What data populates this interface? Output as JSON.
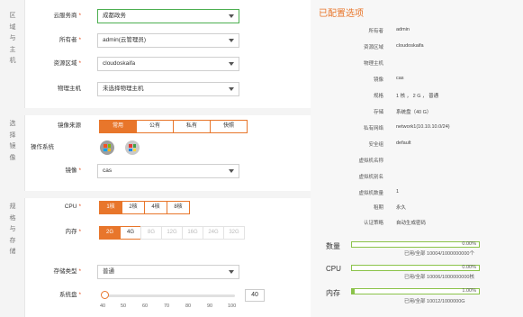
{
  "sections": {
    "region": {
      "tab_label": "区域与主机"
    },
    "image": {
      "tab_label": "选择镜像"
    },
    "spec": {
      "tab_label": "规格与存储"
    }
  },
  "form": {
    "cloud_service_provider": {
      "label": "云服务商",
      "value": "成都政务"
    },
    "owner": {
      "label": "所有者",
      "value": "admin(云管理员)"
    },
    "resource_region": {
      "label": "资源区域",
      "value": "cloudoskaifa"
    },
    "physical_host": {
      "label": "物理主机",
      "value": "未选择物理主机"
    },
    "image_source": {
      "label": "镜像来源",
      "options": [
        "常用",
        "公有",
        "私有",
        "快照"
      ],
      "selected": "常用"
    },
    "os": {
      "label": "操作系统",
      "icons": [
        "windows-icon",
        "windows-color-icon"
      ]
    },
    "image": {
      "label": "镜像",
      "value": "cas"
    },
    "cpu": {
      "label": "CPU",
      "options": [
        "1核",
        "2核",
        "4核",
        "8核"
      ],
      "selected": "1核"
    },
    "memory": {
      "label": "内存",
      "options": [
        "2G",
        "4G",
        "8G",
        "12G",
        "16G",
        "24G",
        "32G"
      ],
      "selected": "2G",
      "disabled": [
        "8G",
        "12G",
        "16G",
        "24G",
        "32G"
      ]
    },
    "storage_type": {
      "label": "存储类型",
      "value": "普通"
    },
    "system_disk": {
      "label": "系统盘",
      "value": "40",
      "min": 40,
      "max": 100,
      "ticks": [
        "40",
        "50",
        "60",
        "70",
        "80",
        "90",
        "100"
      ]
    }
  },
  "summary": {
    "title": "已配置选项",
    "items": [
      {
        "k": "所有者",
        "v": "admin"
      },
      {
        "k": "资源区域",
        "v": "cloudoskaifa"
      },
      {
        "k": "物理主机",
        "v": ""
      },
      {
        "k": "镜像",
        "v": "cas"
      },
      {
        "k": "规格",
        "v": "1 核 ， 2 G ， 普通"
      },
      {
        "k": "存储",
        "v": "系统盘（40 G）"
      },
      {
        "k": "私有网络",
        "v": "network1(10.10.10.0/24)"
      },
      {
        "k": "安全组",
        "v": "default"
      },
      {
        "k": "虚拟机名称",
        "v": ""
      },
      {
        "k": "虚拟机别名",
        "v": ""
      },
      {
        "k": "虚拟机数量",
        "v": "1"
      },
      {
        "k": "租期",
        "v": "永久"
      },
      {
        "k": "认证策略",
        "v": "自动生成密码"
      }
    ]
  },
  "quotas": [
    {
      "label": "数量",
      "percent_text": "0.00%",
      "fraction": 0.0,
      "detail": "已用/全部 10004/1000000000个"
    },
    {
      "label": "CPU",
      "percent_text": "0.00%",
      "fraction": 0.0,
      "detail": "已用/全部 10006/1000000000核"
    },
    {
      "label": "内存",
      "percent_text": "1.00%",
      "fraction": 0.01,
      "detail": "已用/全部 10012/1000000G"
    }
  ],
  "colors": {
    "accent": "#e8762b",
    "ok": "#8bc34a",
    "focus_border": "#4caf50"
  }
}
